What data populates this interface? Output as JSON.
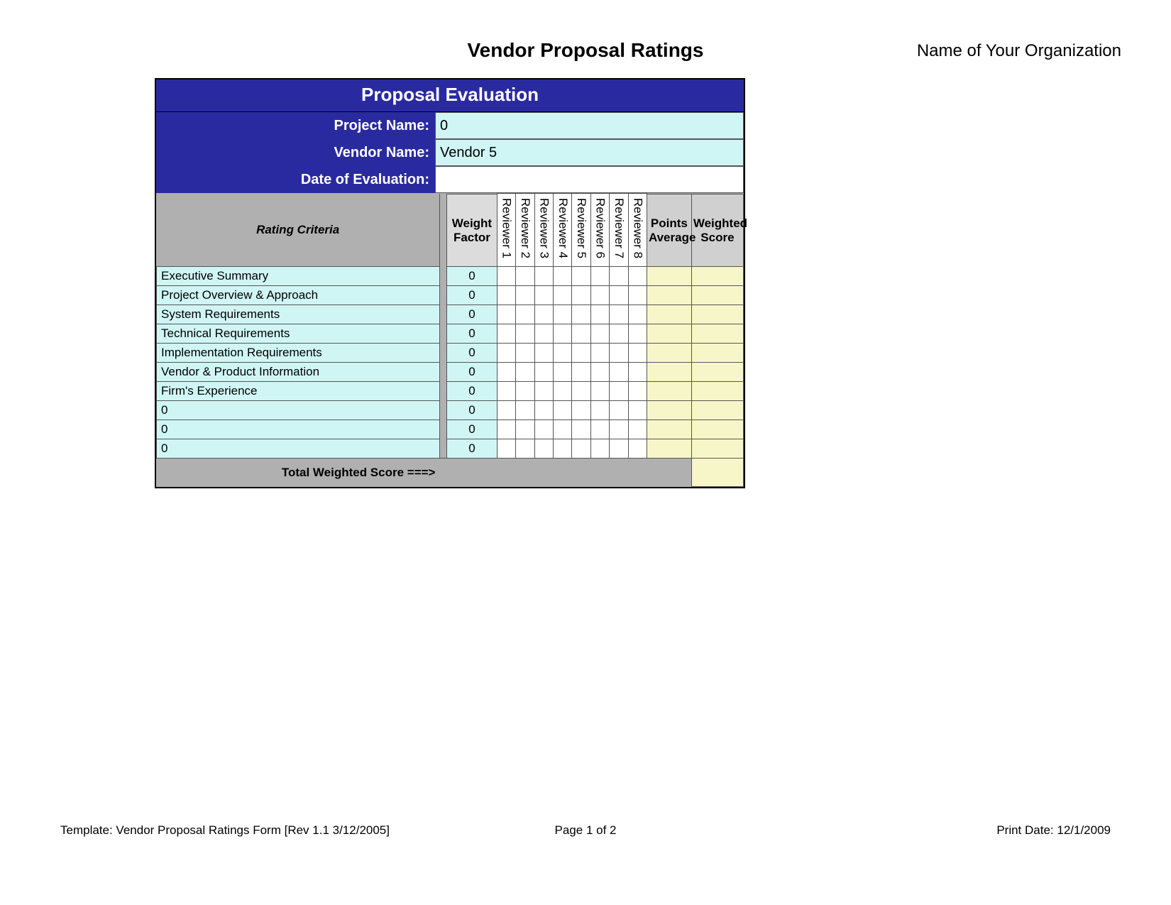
{
  "header": {
    "title": "Vendor Proposal Ratings",
    "org_name": "Name of Your Organization"
  },
  "panel": {
    "eval_title": "Proposal Evaluation",
    "meta": {
      "project_label": "Project Name:",
      "project_value": "0",
      "vendor_label": "Vendor Name:",
      "vendor_value": "Vendor 5",
      "date_label": "Date of Evaluation:",
      "date_value": ""
    },
    "columns": {
      "criteria": "Rating Criteria",
      "weight_factor": "Weight Factor",
      "reviewers": [
        "Reviewer 1",
        "Reviewer 2",
        "Reviewer 3",
        "Reviewer 4",
        "Reviewer 5",
        "Reviewer 6",
        "Reviewer 7",
        "Reviewer 8"
      ],
      "points_avg": "Points Average",
      "weighted_score": "Weighted Score"
    },
    "rows": [
      {
        "criteria": "Executive Summary",
        "wf": "0"
      },
      {
        "criteria": "Project Overview & Approach",
        "wf": "0"
      },
      {
        "criteria": "System Requirements",
        "wf": "0"
      },
      {
        "criteria": "Technical Requirements",
        "wf": "0"
      },
      {
        "criteria": "Implementation Requirements",
        "wf": "0"
      },
      {
        "criteria": "Vendor & Product Information",
        "wf": "0"
      },
      {
        "criteria": "Firm's Experience",
        "wf": "0"
      },
      {
        "criteria": "0",
        "wf": "0"
      },
      {
        "criteria": "0",
        "wf": "0"
      },
      {
        "criteria": "0",
        "wf": "0"
      }
    ],
    "total_label": "Total Weighted Score ===>"
  },
  "footer": {
    "template": "Template: Vendor Proposal Ratings Form [Rev 1.1 3/12/2005]",
    "page": "Page 1 of 2",
    "print_date": "Print Date: 12/1/2009"
  }
}
